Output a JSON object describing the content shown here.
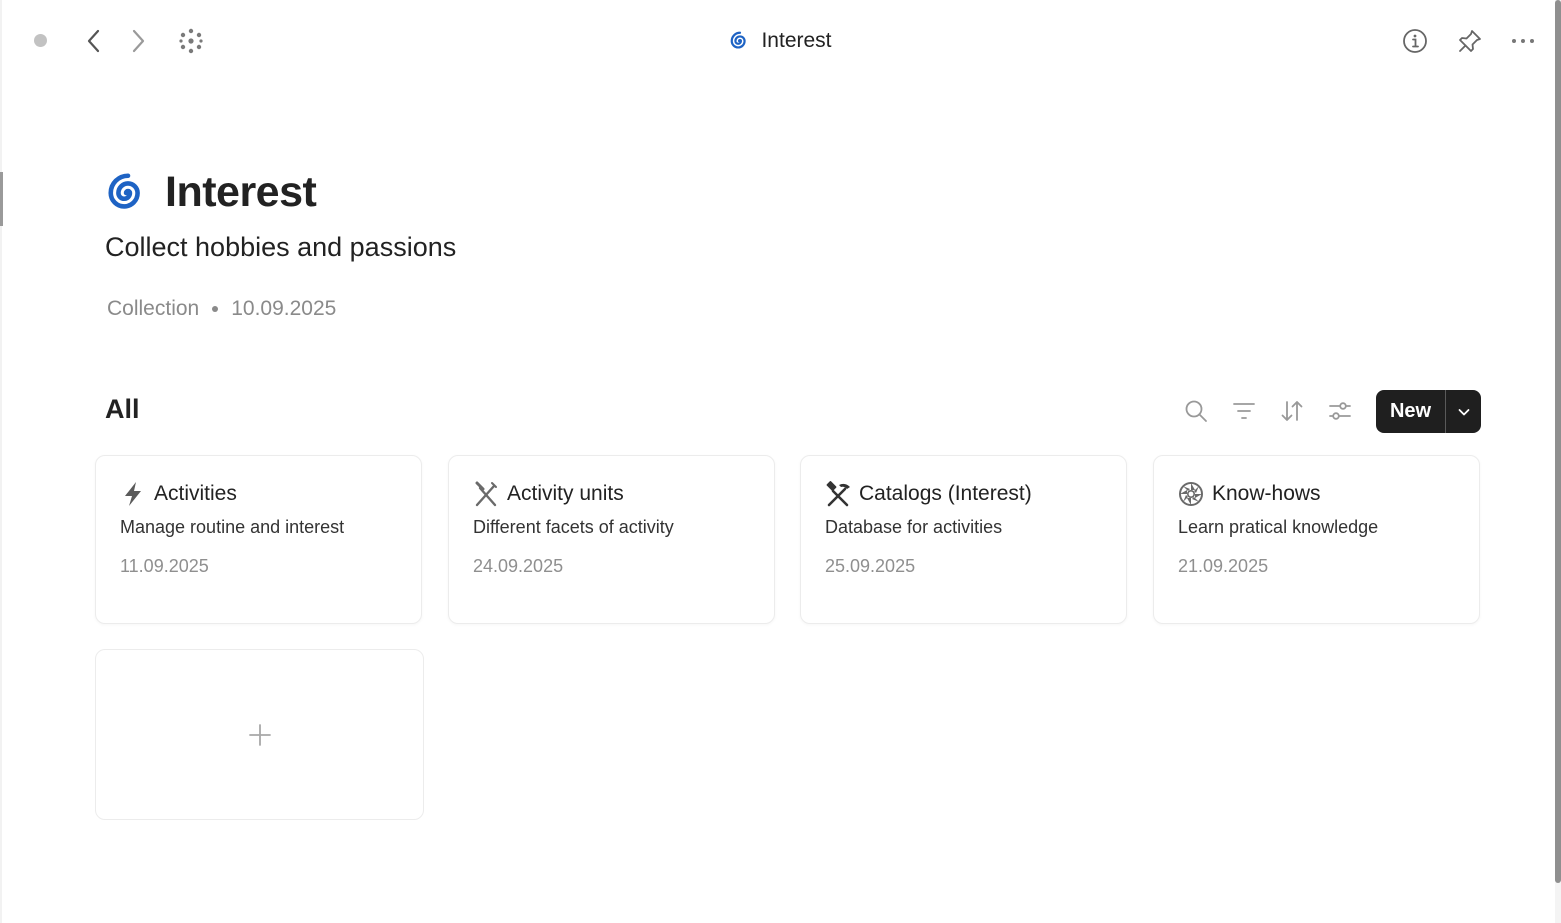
{
  "window": {
    "title": "Interest",
    "title_icon": "cyclone-icon"
  },
  "toolbar": {
    "left_icons": [
      "status-dot",
      "chevron-left-icon",
      "chevron-right-icon",
      "graph-icon"
    ],
    "right_icons": [
      "info-icon",
      "pin-icon",
      "more-icon"
    ]
  },
  "page": {
    "title": "Interest",
    "icon": "cyclone-icon",
    "description": "Collect hobbies and passions",
    "type": "Collection",
    "date": "10.09.2025"
  },
  "view": {
    "title": "All",
    "tools": [
      "search-icon",
      "filter-icon",
      "sort-icon",
      "settings-icon"
    ],
    "new_label": "New"
  },
  "cards": [
    {
      "icon": "lightning-icon",
      "title": "Activities",
      "description": "Manage routine and interest",
      "date": "11.09.2025"
    },
    {
      "icon": "crossed-tools-icon",
      "title": "Activity units",
      "description": "Different facets of activity",
      "date": "24.09.2025"
    },
    {
      "icon": "hammer-pick-icon",
      "title": "Catalogs (Interest)",
      "description": "Database for activities",
      "date": "25.09.2025"
    },
    {
      "icon": "aperture-icon",
      "title": "Know-hows",
      "description": "Learn pratical knowledge",
      "date": "21.09.2025"
    }
  ],
  "add_card": {
    "icon": "plus-icon"
  },
  "colors": {
    "accent_dark": "#1f1f1f",
    "muted_text": "#8a8a8a",
    "cyclone_blue": "#1565c0"
  }
}
